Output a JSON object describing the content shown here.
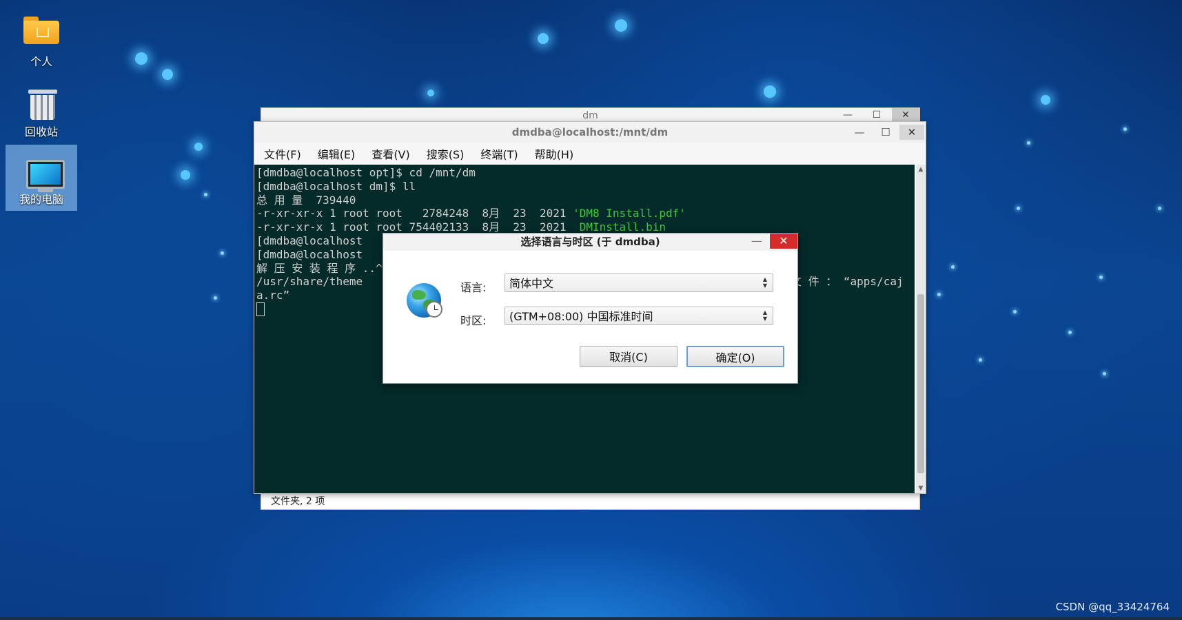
{
  "desktop": {
    "icons": [
      {
        "label": "个人"
      },
      {
        "label": "回收站"
      },
      {
        "label": "我的电脑"
      }
    ]
  },
  "back_window": {
    "title": "dm",
    "status": "文件夹, 2 项"
  },
  "terminal": {
    "title": "dmdba@localhost:/mnt/dm",
    "menu": [
      "文件(F)",
      "编辑(E)",
      "查看(V)",
      "搜索(S)",
      "终端(T)",
      "帮助(H)"
    ],
    "lines": [
      "[dmdba@localhost opt]$ cd /mnt/dm",
      "[dmdba@localhost dm]$ ll",
      "总 用 量  739440",
      "-r-xr-xr-x 1 root root   2784248  8月  23  2021 ",
      "-r-xr-xr-x 1 root root 754402133  8月  23  2021  ",
      "[dmdba@localhost",
      "[dmdba@localhost",
      "解 压 安 装 程 序 ..^.",
      "/usr/share/theme",
      "a.rc”"
    ],
    "green_files": [
      "'DM8 Install.pdf'",
      "DMInstall.bin"
    ],
    "hidden_tail": "文 件 ： “apps/caj"
  },
  "dialog": {
    "title": "选择语言与时区 (于 dmdba)",
    "language_label": "语言:",
    "language_value": "简体中文",
    "timezone_label": "时区:",
    "timezone_value": "(GTM+08:00) 中国标准时间",
    "cancel_label": "取消(C)",
    "ok_label": "确定(O)"
  },
  "watermark": "CSDN @qq_33424764"
}
